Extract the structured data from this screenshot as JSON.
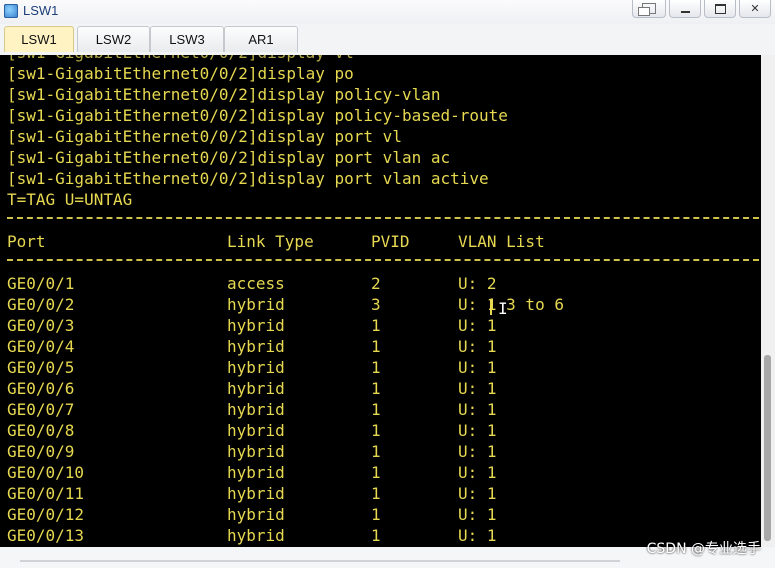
{
  "window": {
    "title": "LSW1",
    "controls": [
      "restore",
      "minimize",
      "maximize",
      "close"
    ]
  },
  "tabs": [
    {
      "label": "LSW1",
      "active": true
    },
    {
      "label": "LSW2",
      "active": false
    },
    {
      "label": "LSW3",
      "active": false
    },
    {
      "label": "AR1",
      "active": false
    }
  ],
  "terminal": {
    "clipped_line": "[sw1-GigabitEthernet0/0/2]display vl",
    "commands": [
      "[sw1-GigabitEthernet0/0/2]display po",
      "[sw1-GigabitEthernet0/0/2]display policy-vlan",
      "[sw1-GigabitEthernet0/0/2]display policy-based-route",
      "[sw1-GigabitEthernet0/0/2]display port vl",
      "[sw1-GigabitEthernet0/0/2]display port vlan ac",
      "[sw1-GigabitEthernet0/0/2]display port vlan active"
    ],
    "legend": "T=TAG U=UNTAG",
    "table": {
      "headers": {
        "port": "Port",
        "link_type": "Link Type",
        "pvid": "PVID",
        "vlan_list": "VLAN List"
      },
      "rows": [
        {
          "port": "GE0/0/1",
          "link_type": "access",
          "pvid": "2",
          "vlan_list": "U: 2"
        },
        {
          "port": "GE0/0/2",
          "link_type": "hybrid",
          "pvid": "3",
          "vlan_list": "U: 1 3 to 6"
        },
        {
          "port": "GE0/0/3",
          "link_type": "hybrid",
          "pvid": "1",
          "vlan_list": "U: 1"
        },
        {
          "port": "GE0/0/4",
          "link_type": "hybrid",
          "pvid": "1",
          "vlan_list": "U: 1"
        },
        {
          "port": "GE0/0/5",
          "link_type": "hybrid",
          "pvid": "1",
          "vlan_list": "U: 1"
        },
        {
          "port": "GE0/0/6",
          "link_type": "hybrid",
          "pvid": "1",
          "vlan_list": "U: 1"
        },
        {
          "port": "GE0/0/7",
          "link_type": "hybrid",
          "pvid": "1",
          "vlan_list": "U: 1"
        },
        {
          "port": "GE0/0/8",
          "link_type": "hybrid",
          "pvid": "1",
          "vlan_list": "U: 1"
        },
        {
          "port": "GE0/0/9",
          "link_type": "hybrid",
          "pvid": "1",
          "vlan_list": "U: 1"
        },
        {
          "port": "GE0/0/10",
          "link_type": "hybrid",
          "pvid": "1",
          "vlan_list": "U: 1"
        },
        {
          "port": "GE0/0/11",
          "link_type": "hybrid",
          "pvid": "1",
          "vlan_list": "U: 1"
        },
        {
          "port": "GE0/0/12",
          "link_type": "hybrid",
          "pvid": "1",
          "vlan_list": "U: 1"
        },
        {
          "port": "GE0/0/13",
          "link_type": "hybrid",
          "pvid": "1",
          "vlan_list": "U: 1"
        }
      ]
    }
  },
  "watermark": "CSDN @专业选手",
  "colors": {
    "terminal_bg": "#000000",
    "terminal_text": "#e6d850",
    "active_tab": "#fff3c4"
  }
}
